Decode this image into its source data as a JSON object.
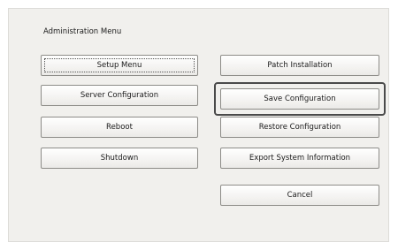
{
  "menu": {
    "title": "Administration Menu",
    "left_buttons": [
      {
        "label": "Setup Menu"
      },
      {
        "label": "Server Configuration"
      },
      {
        "label": "Reboot"
      },
      {
        "label": "Shutdown"
      }
    ],
    "right_buttons": [
      {
        "label": "Patch Installation"
      },
      {
        "label": "Save Configuration"
      },
      {
        "label": "Restore Configuration"
      },
      {
        "label": "Export System Information"
      },
      {
        "label": "Cancel"
      }
    ]
  }
}
